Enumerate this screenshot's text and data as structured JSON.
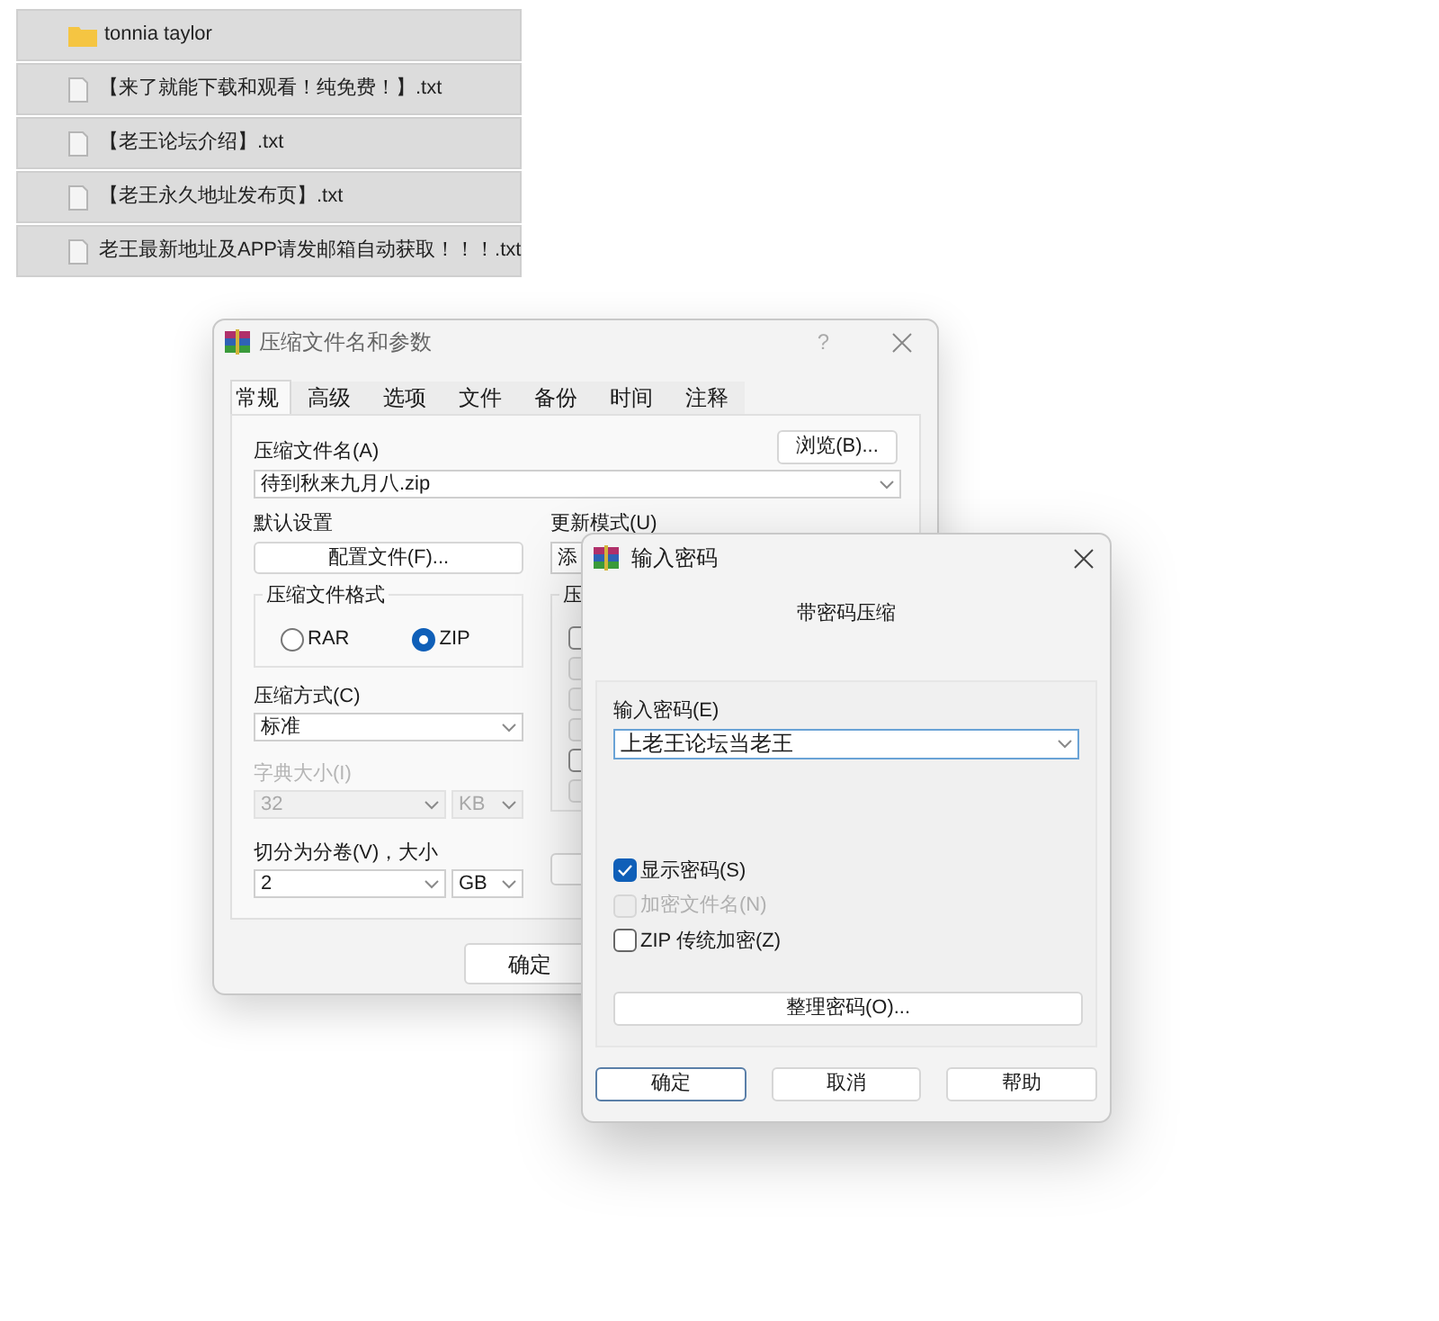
{
  "file_list": [
    {
      "kind": "folder",
      "name": "tonnia taylor"
    },
    {
      "kind": "text_file",
      "name": "【来了就能下载和观看！纯免费！】.txt"
    },
    {
      "kind": "text_file",
      "name": "【老王论坛介绍】.txt"
    },
    {
      "kind": "text_file",
      "name": "【老王永久地址发布页】.txt"
    },
    {
      "kind": "text_file",
      "name": "老王最新地址及APP请发邮箱自动获取！！！.txt"
    }
  ],
  "archive_dialog": {
    "title": "压缩文件名和参数",
    "help_button": "?",
    "tabs": [
      {
        "label": "常规",
        "selected": true
      },
      {
        "label": "高级",
        "selected": false
      },
      {
        "label": "选项",
        "selected": false
      },
      {
        "label": "文件",
        "selected": false
      },
      {
        "label": "备份",
        "selected": false
      },
      {
        "label": "时间",
        "selected": false
      },
      {
        "label": "注释",
        "selected": false
      }
    ],
    "archive_name_label": "压缩文件名(A)",
    "browse_button": "浏览(B)...",
    "archive_name": "待到秋来九月八.zip",
    "profiles_label": "默认设置",
    "profiles_button": "配置文件(F)...",
    "update_mode_label": "更新模式(U)",
    "update_mode": "添",
    "format_group": {
      "label": "压缩文件格式",
      "options": [
        {
          "label": "RAR",
          "selected": false
        },
        {
          "label": "ZIP",
          "selected": true
        }
      ]
    },
    "options_group": {
      "label": "压",
      "checkboxes": [
        {
          "checked": false,
          "disabled": false
        },
        {
          "checked": false,
          "disabled": true
        },
        {
          "checked": false,
          "disabled": true
        },
        {
          "checked": false,
          "disabled": true
        },
        {
          "checked": false,
          "disabled": false
        },
        {
          "checked": false,
          "disabled": true
        }
      ]
    },
    "method": {
      "label": "压缩方式(C)",
      "value": "标准"
    },
    "dictionary": {
      "label": "字典大小(I)",
      "value": "32",
      "unit": "KB",
      "disabled": true
    },
    "split": {
      "label": "切分为分卷(V)，大小",
      "value": "2",
      "unit": "GB"
    },
    "ok_button": "确定"
  },
  "password_dialog": {
    "title": "输入密码",
    "heading": "带密码压缩",
    "password_label": "输入密码(E)",
    "password": "上老王论坛当老王",
    "checkboxes": [
      {
        "label": "显示密码(S)",
        "checked": true,
        "disabled": false
      },
      {
        "label": "加密文件名(N)",
        "checked": false,
        "disabled": true
      },
      {
        "label": "ZIP 传统加密(Z)",
        "checked": false,
        "disabled": false
      }
    ],
    "organize_button": "整理密码(O)...",
    "buttons": [
      {
        "label": "确定",
        "default": true
      },
      {
        "label": "取消",
        "default": false
      },
      {
        "label": "帮助",
        "default": false
      }
    ]
  }
}
